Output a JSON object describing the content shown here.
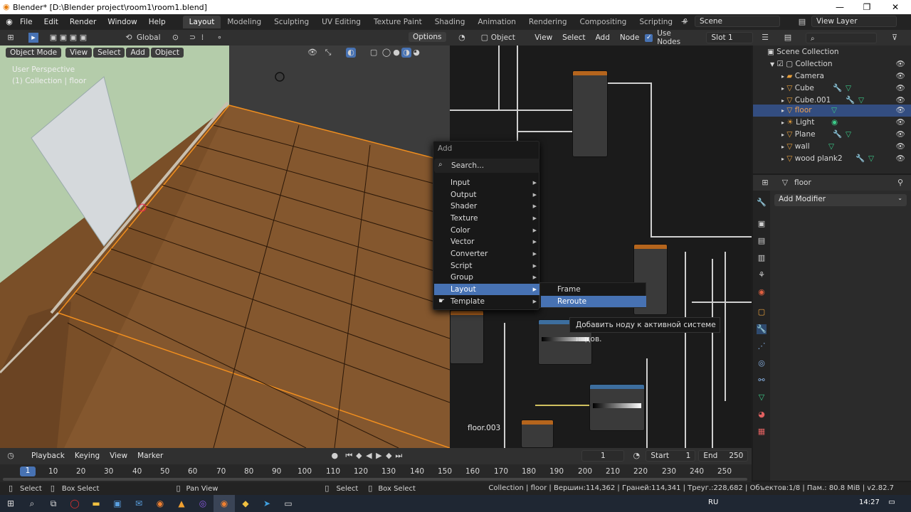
{
  "window": {
    "title": "Blender* [D:\\Blender project\\room1\\room1.blend]"
  },
  "menu": [
    "File",
    "Edit",
    "Render",
    "Window",
    "Help"
  ],
  "workspaces": [
    "Layout",
    "Modeling",
    "Sculpting",
    "UV Editing",
    "Texture Paint",
    "Shading",
    "Animation",
    "Rendering",
    "Compositing",
    "Scripting"
  ],
  "scene": "Scene",
  "view_layer": "View Layer",
  "viewport": {
    "transform": "Global",
    "options": "Options",
    "mode": "Object Mode",
    "menus": [
      "View",
      "Select",
      "Add",
      "Object"
    ],
    "overlay_title": "User Perspective",
    "overlay_sub": "(1) Collection | floor"
  },
  "node_editor": {
    "type": "Object",
    "menus": [
      "View",
      "Select",
      "Add",
      "Node"
    ],
    "use_nodes": "Use Nodes",
    "slot": "Slot 1",
    "material_name": "floor.003"
  },
  "add_menu": {
    "title": "Add",
    "search": "Search...",
    "items": [
      "Input",
      "Output",
      "Shader",
      "Texture",
      "Color",
      "Vector",
      "Converter",
      "Script",
      "Group",
      "Layout",
      "Template"
    ],
    "highlighted": "Layout"
  },
  "submenu": {
    "items": [
      "Frame",
      "Reroute"
    ],
    "highlighted": "Reroute"
  },
  "tooltip": "Добавить ноду к активной системе нодов.",
  "outliner": {
    "root": "Scene Collection",
    "collection": "Collection",
    "items": [
      "Camera",
      "Cube",
      "Cube.001",
      "floor",
      "Light",
      "Plane",
      "wall",
      "wood plank2"
    ],
    "selected": "floor"
  },
  "properties": {
    "object": "floor",
    "add_modifier": "Add Modifier"
  },
  "timeline": {
    "menus": [
      "Playback",
      "Keying",
      "View",
      "Marker"
    ],
    "current": "1",
    "start_label": "Start",
    "start": "1",
    "end_label": "End",
    "end": "250",
    "ticks": [
      "1",
      "10",
      "20",
      "30",
      "40",
      "50",
      "60",
      "70",
      "80",
      "90",
      "100",
      "110",
      "120",
      "130",
      "140",
      "150",
      "160",
      "170",
      "180",
      "190",
      "200",
      "210",
      "220",
      "230",
      "240",
      "250"
    ]
  },
  "status": {
    "left": [
      "Select",
      "Box Select",
      "Pan View",
      "Select",
      "Box Select"
    ],
    "stats": "Collection | floor | Вершин:114,362 | Граней:114,341 | Треуг.:228,682 | Объектов:1/8 | Пам.: 80.8 MiB | v2.82.7"
  },
  "taskbar": {
    "lang": "RU",
    "time": "14:27"
  }
}
